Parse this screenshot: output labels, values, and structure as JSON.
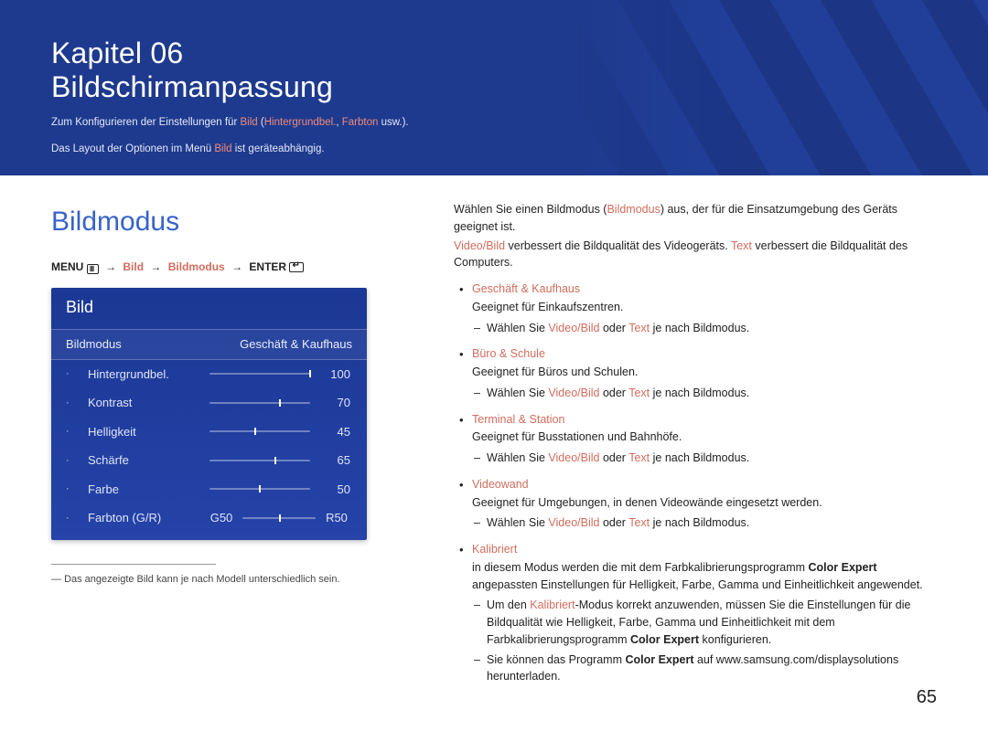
{
  "hero": {
    "chapter_line": "Kapitel 06",
    "title": "Bildschirmanpassung",
    "intro_prefix": "Zum Konfigurieren der Einstellungen für ",
    "intro_hl1": "Bild",
    "intro_paren_open": " (",
    "intro_hl2": "Hintergrundbel.",
    "intro_sep": ", ",
    "intro_hl3": "Farbton",
    "intro_suffix": " usw.).",
    "intro2_prefix": "Das Layout der Optionen im Menü ",
    "intro2_hl": "Bild",
    "intro2_suffix": " ist geräteabhängig."
  },
  "left": {
    "section_title": "Bildmodus",
    "menu_path": {
      "menu_label": "MENU",
      "p1": "Bild",
      "p2": "Bildmodus",
      "enter_label": "ENTER"
    },
    "osd": {
      "panel_title": "Bild",
      "sub_left": "Bildmodus",
      "sub_right": "Geschäft & Kaufhaus",
      "rows": [
        {
          "label": "Hintergrundbel.",
          "value": 100,
          "pct": 100
        },
        {
          "label": "Kontrast",
          "value": 70,
          "pct": 70
        },
        {
          "label": "Helligkeit",
          "value": 45,
          "pct": 45
        },
        {
          "label": "Schärfe",
          "value": 65,
          "pct": 65
        },
        {
          "label": "Farbe",
          "value": 50,
          "pct": 50
        }
      ],
      "gr_row": {
        "label": "Farbton (G/R)",
        "left": "G50",
        "right": "R50"
      }
    },
    "footnote": "Das angezeigte Bild kann je nach Modell unterschiedlich sein."
  },
  "right": {
    "line1_a": "Wählen Sie einen Bildmodus (",
    "line1_hl": "Bildmodus",
    "line1_b": ") aus, der für die Einsatzumgebung des Geräts geeignet ist.",
    "line2_hl1": "Video/Bild",
    "line2_mid": " verbessert die Bildqualität des Videogeräts. ",
    "line2_hl2": "Text",
    "line2_end": " verbessert die Bildqualität des Computers.",
    "select_prefix": "Wählen Sie ",
    "select_vb": "Video/Bild",
    "select_or": " oder ",
    "select_tx": "Text",
    "select_suffix": " je nach Bildmodus.",
    "modes": [
      {
        "title": "Geschäft & Kaufhaus",
        "desc": "Geeignet für Einkaufszentren.",
        "select": true
      },
      {
        "title": "Büro & Schule",
        "desc": "Geeignet für Büros und Schulen.",
        "select": true
      },
      {
        "title": "Terminal & Station",
        "desc": "Geeignet für Busstationen und Bahnhöfe.",
        "select": true
      },
      {
        "title": "Videowand",
        "desc": "Geeignet für Umgebungen, in denen Videowände eingesetzt werden.",
        "select": true
      },
      {
        "title": "Kalibriert",
        "desc": "in diesem Modus werden die mit dem Farbkalibrierungsprogramm Color Expert angepassten Einstellungen für Helligkeit, Farbe, Gamma und Einheitlichkeit angewendet.",
        "select": false
      }
    ],
    "calibrated_sub": {
      "a_prefix": "Um den ",
      "a_hl": "Kalibriert",
      "a_mid": "-Modus korrekt anzuwenden, müssen Sie die Einstellungen für die Bildqualität wie Helligkeit, Farbe, Gamma und Einheitlichkeit mit dem Farbkalibrierungsprogramm ",
      "a_b": "Color Expert",
      "a_end": " konfigurieren.",
      "b_prefix": "Sie können das Programm ",
      "b_b": "Color Expert",
      "b_end": " auf www.samsung.com/displaysolutions herunterladen."
    }
  },
  "page_number": "65"
}
